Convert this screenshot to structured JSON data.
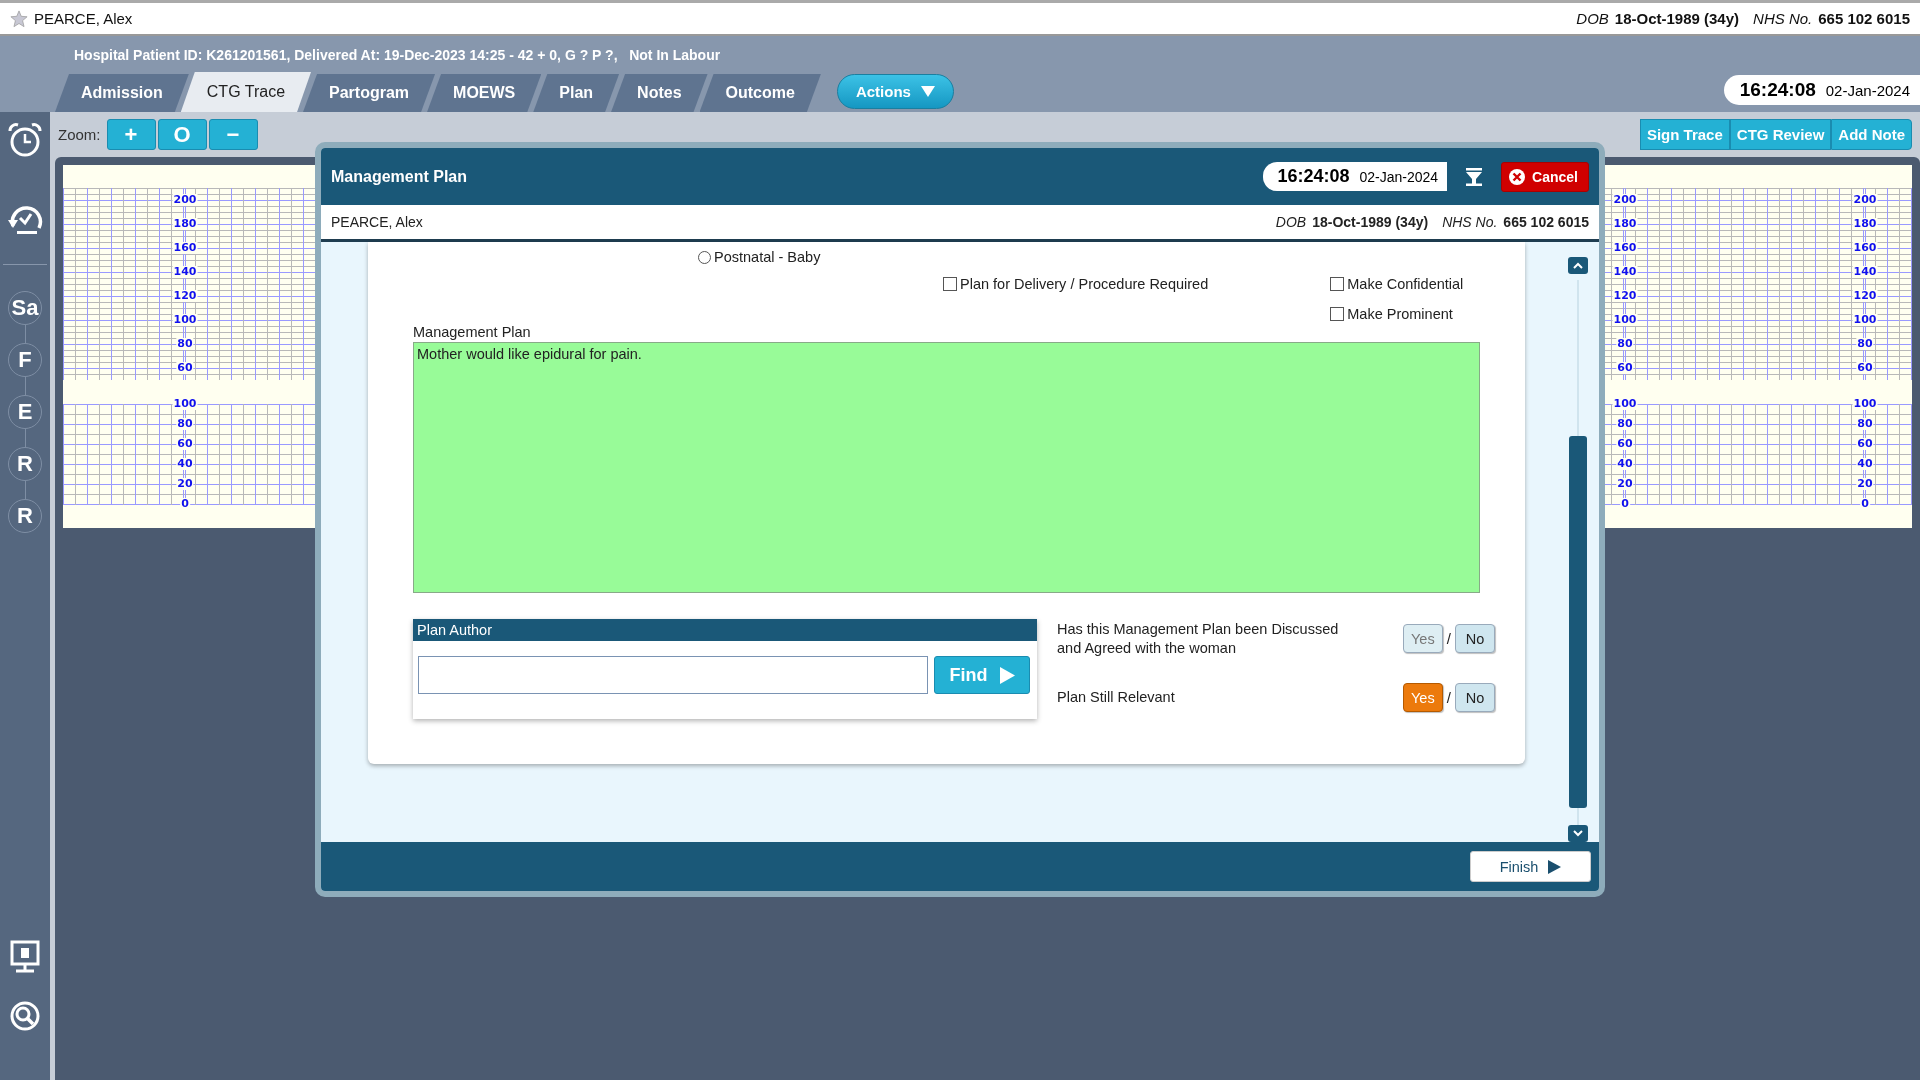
{
  "patient_bar": {
    "name": "PEARCE, Alex",
    "dob_label": "DOB",
    "dob": "18-Oct-1989 (34y)",
    "nhs_label": "NHS No.",
    "nhs": "665 102 6015"
  },
  "info_line": "Hospital Patient ID: K261201561, Delivered At: 19-Dec-2023 14:25 - 42 + 0, G ? P ?,   Not In Labour",
  "tabs": [
    {
      "label": "Admission",
      "selected": false
    },
    {
      "label": "CTG Trace",
      "selected": true
    },
    {
      "label": "Partogram",
      "selected": false
    },
    {
      "label": "MOEWS",
      "selected": false
    },
    {
      "label": "Plan",
      "selected": false
    },
    {
      "label": "Notes",
      "selected": false
    },
    {
      "label": "Outcome",
      "selected": false
    }
  ],
  "actions_button": "Actions",
  "clock": {
    "time": "16:24:08",
    "date": "02-Jan-2024"
  },
  "sidebar": {
    "steps": [
      "Sa",
      "F",
      "E",
      "R",
      "R"
    ]
  },
  "toolbar": {
    "zoom_label": "Zoom:",
    "zoom_buttons": [
      "+",
      "O",
      "−"
    ],
    "buttons": [
      "Sign Trace",
      "CTG Review",
      "Add Note"
    ]
  },
  "ctg": {
    "axes": [
      {
        "fhr": [
          "200",
          "180",
          "160",
          "140",
          "120",
          "100",
          "80",
          "60"
        ],
        "toco": [
          "100",
          "80",
          "60",
          "40",
          "20",
          "0"
        ]
      },
      {
        "fhr": [
          "200",
          "180",
          "160",
          "140",
          "120",
          "100",
          "80",
          "60"
        ],
        "toco": [
          "100",
          "80",
          "60",
          "40",
          "20",
          "0"
        ]
      },
      {
        "fhr": [
          "200",
          "180",
          "160",
          "140",
          "120",
          "100",
          "80",
          "60"
        ],
        "toco": [
          "100",
          "80",
          "60",
          "40",
          "20",
          "0"
        ]
      }
    ]
  },
  "dialog": {
    "title": "Management Plan",
    "clock": {
      "time": "16:24:08",
      "date": "02-Jan-2024"
    },
    "cancel_button": "Cancel",
    "patient": {
      "name": "PEARCE, Alex",
      "dob_label": "DOB",
      "dob": "18-Oct-1989 (34y)",
      "nhs_label": "NHS No.",
      "nhs": "665 102 6015"
    },
    "radio": {
      "label": "Postnatal - Baby",
      "selected": false
    },
    "checkboxes": [
      {
        "label": "Plan for Delivery / Procedure Required",
        "checked": false
      },
      {
        "label": "Make Confidential",
        "checked": false
      },
      {
        "label": "Make Prominent",
        "checked": false
      }
    ],
    "plan_label": "Management Plan",
    "plan_text": "Mother would like epidural for pain.",
    "plan_author": {
      "title": "Plan Author",
      "find_button": "Find"
    },
    "questions": [
      {
        "text": "Has this Management Plan been Discussed and Agreed with the woman",
        "separator": "/",
        "options": [
          {
            "label": "Yes",
            "selected": false,
            "disabled": true
          },
          {
            "label": "No",
            "selected": false,
            "disabled": false
          }
        ]
      },
      {
        "text": "Plan Still Relevant",
        "separator": "/",
        "options": [
          {
            "label": "Yes",
            "selected": true,
            "disabled": false
          },
          {
            "label": "No",
            "selected": false,
            "disabled": false
          }
        ]
      }
    ],
    "finish_button": "Finish"
  }
}
